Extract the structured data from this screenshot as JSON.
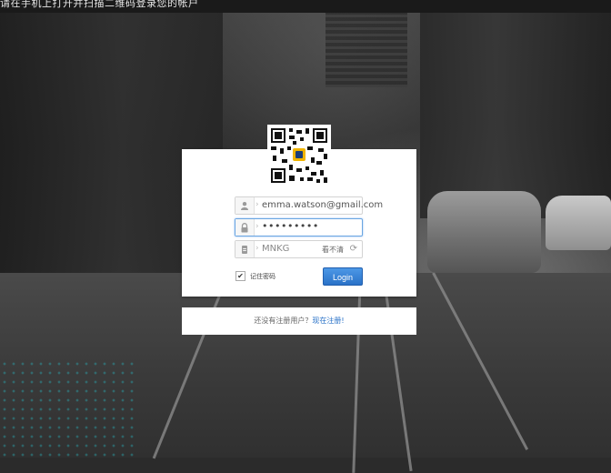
{
  "header": {
    "title_text": "请在手机上打开并扫描二维码登录您的帐户"
  },
  "login": {
    "email_value": "emma.watson@gmail.com",
    "password_value": "•••••••••",
    "captcha_value": "MNKG",
    "captcha_hint": "看不清",
    "remember_label": "记住密码",
    "remember_checked": true,
    "login_button": "Login"
  },
  "register": {
    "prompt": "还没有注册用户？",
    "link": "现在注册!"
  },
  "icons": {
    "email": "user-icon",
    "password": "lock-icon",
    "captcha": "captcha-icon",
    "refresh": "refresh-icon",
    "qr": "qr-code"
  },
  "colors": {
    "accent": "#2a72c8",
    "card": "#ffffff",
    "focus_border": "#6aa5e2"
  }
}
